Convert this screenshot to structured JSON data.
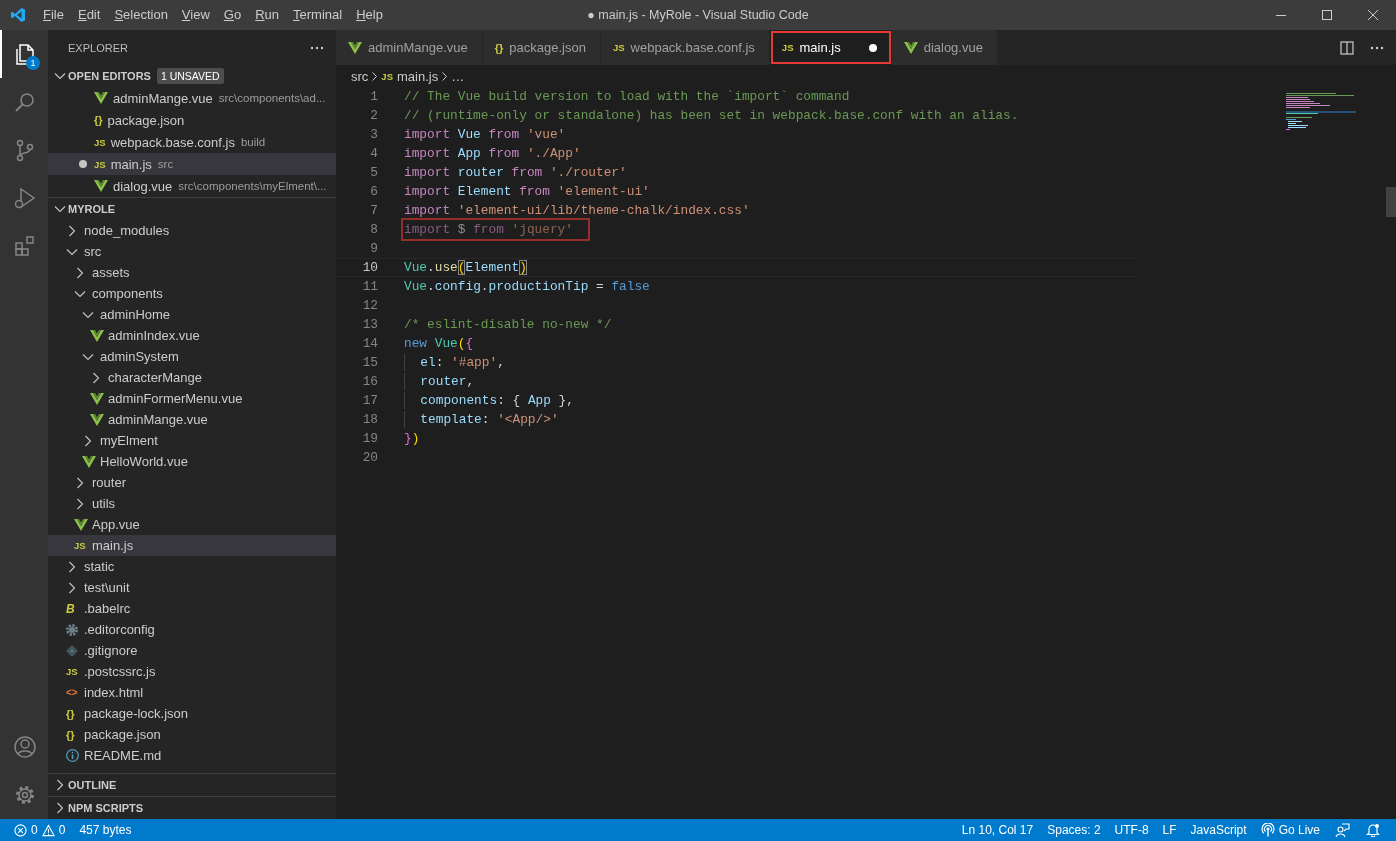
{
  "title_bar": {
    "menu": [
      "File",
      "Edit",
      "Selection",
      "View",
      "Go",
      "Run",
      "Terminal",
      "Help"
    ],
    "title": "● main.js - MyRole - Visual Studio Code"
  },
  "activity_bar": {
    "top": [
      {
        "kind": "files",
        "selected": true,
        "badge": "1"
      },
      {
        "kind": "search",
        "selected": false
      },
      {
        "kind": "source-control",
        "selected": false
      },
      {
        "kind": "run",
        "selected": false
      },
      {
        "kind": "extensions",
        "selected": false
      }
    ],
    "bottom": [
      {
        "kind": "account",
        "selected": false
      },
      {
        "kind": "settings",
        "selected": false
      }
    ]
  },
  "sidebar": {
    "title": "EXPLORER",
    "open_editors": {
      "title": "OPEN EDITORS",
      "expanded": true,
      "badge": "1 UNSAVED",
      "items": [
        {
          "name": "adminMange.vue",
          "description": "src\\components\\ad...",
          "kind": "vue",
          "dirty": false,
          "selected": false
        },
        {
          "name": "package.json",
          "kind": "json",
          "icon_text": "{}",
          "dirty": false,
          "selected": false
        },
        {
          "name": "webpack.base.conf.js",
          "description": "build",
          "kind": "js",
          "icon_text": "JS",
          "dirty": false,
          "selected": false
        },
        {
          "name": "main.js",
          "description": "src",
          "kind": "js",
          "icon_text": "JS",
          "dirty": true,
          "selected": true
        },
        {
          "name": "dialog.vue",
          "description": "src\\components\\myElment\\...",
          "kind": "vue",
          "dirty": false,
          "selected": false
        }
      ]
    },
    "folder": {
      "title": "MYROLE",
      "expanded": true,
      "tree": [
        {
          "name": "node_modules",
          "kind": "folder",
          "expanded": false,
          "selected": false
        },
        {
          "name": "src",
          "kind": "folder",
          "expanded": true,
          "selected": false,
          "children": [
            {
              "name": "assets",
              "kind": "folder",
              "expanded": false,
              "selected": false
            },
            {
              "name": "components",
              "kind": "folder",
              "expanded": true,
              "selected": false,
              "children": [
                {
                  "name": "adminHome",
                  "kind": "folder",
                  "expanded": true,
                  "selected": false,
                  "children": [
                    {
                      "name": "adminIndex.vue",
                      "kind": "vue",
                      "selected": false
                    }
                  ]
                },
                {
                  "name": "adminSystem",
                  "kind": "folder",
                  "expanded": true,
                  "selected": false,
                  "children": [
                    {
                      "name": "characterMange",
                      "kind": "folder",
                      "expanded": false,
                      "selected": false
                    },
                    {
                      "name": "adminFormerMenu.vue",
                      "kind": "vue",
                      "selected": false
                    },
                    {
                      "name": "adminMange.vue",
                      "kind": "vue",
                      "selected": false
                    }
                  ]
                },
                {
                  "name": "myElment",
                  "kind": "folder",
                  "expanded": false,
                  "selected": false
                },
                {
                  "name": "HelloWorld.vue",
                  "kind": "vue",
                  "selected": false
                }
              ]
            },
            {
              "name": "router",
              "kind": "folder",
              "expanded": false,
              "selected": false
            },
            {
              "name": "utils",
              "kind": "folder",
              "expanded": false,
              "selected": false
            },
            {
              "name": "App.vue",
              "kind": "vue",
              "selected": false
            },
            {
              "name": "main.js",
              "kind": "js",
              "icon_text": "JS",
              "selected": true
            }
          ]
        },
        {
          "name": "static",
          "kind": "folder",
          "expanded": false,
          "selected": false
        },
        {
          "name": "test\\unit",
          "kind": "folder",
          "expanded": false,
          "selected": false
        },
        {
          "name": ".babelrc",
          "kind": "babel",
          "icon_text": "B",
          "selected": false
        },
        {
          "name": ".editorconfig",
          "kind": "gear",
          "selected": false
        },
        {
          "name": ".gitignore",
          "kind": "git",
          "selected": false
        },
        {
          "name": ".postcssrc.js",
          "kind": "js",
          "icon_text": "JS",
          "selected": false
        },
        {
          "name": "index.html",
          "kind": "html",
          "icon_text": "<>",
          "selected": false
        },
        {
          "name": "package-lock.json",
          "kind": "json",
          "icon_text": "{}",
          "selected": false
        },
        {
          "name": "package.json",
          "kind": "json",
          "icon_text": "{}",
          "selected": false
        },
        {
          "name": "README.md",
          "kind": "info",
          "selected": false
        }
      ]
    },
    "collapsed_sections": [
      {
        "title": "OUTLINE",
        "expanded": false
      },
      {
        "title": "NPM SCRIPTS",
        "expanded": false
      }
    ]
  },
  "editor": {
    "tabs": [
      {
        "label": "adminMange.vue",
        "kind": "vue",
        "selected": false,
        "dirty": false,
        "annotated": false
      },
      {
        "label": "package.json",
        "kind": "json",
        "icon_text": "{}",
        "selected": false,
        "dirty": false,
        "annotated": false
      },
      {
        "label": "webpack.base.conf.js",
        "kind": "js",
        "icon_text": "JS",
        "selected": false,
        "dirty": false,
        "annotated": false
      },
      {
        "label": "main.js",
        "kind": "js",
        "icon_text": "JS",
        "selected": true,
        "dirty": true,
        "annotated": true
      },
      {
        "label": "dialog.vue",
        "kind": "vue",
        "selected": false,
        "dirty": false,
        "annotated": false
      }
    ],
    "breadcrumb": [
      {
        "label": "src"
      },
      {
        "label": "main.js",
        "kind": "js",
        "icon_text": "JS"
      },
      {
        "label": "…"
      }
    ],
    "lines": [
      {
        "number": "1",
        "current": false,
        "faded": false,
        "annotated": false,
        "guide": false,
        "tokens": [
          {
            "text": "// The Vue build version to load with the `import` command",
            "kind": "com"
          }
        ]
      },
      {
        "number": "2",
        "current": false,
        "faded": false,
        "annotated": false,
        "guide": false,
        "tokens": [
          {
            "text": "// (runtime-only or standalone) has been set in webpack.base.conf with an alias.",
            "kind": "com"
          }
        ]
      },
      {
        "number": "3",
        "current": false,
        "faded": false,
        "annotated": false,
        "guide": false,
        "tokens": [
          {
            "text": "import",
            "kind": "kw"
          },
          {
            "text": " Vue",
            "kind": "var"
          },
          {
            "text": " from",
            "kind": "kw"
          },
          {
            "text": " 'vue'",
            "kind": "str"
          }
        ]
      },
      {
        "number": "4",
        "current": false,
        "faded": false,
        "annotated": false,
        "guide": false,
        "tokens": [
          {
            "text": "import",
            "kind": "kw"
          },
          {
            "text": " App",
            "kind": "var"
          },
          {
            "text": " from",
            "kind": "kw"
          },
          {
            "text": " './App'",
            "kind": "str"
          }
        ]
      },
      {
        "number": "5",
        "current": false,
        "faded": false,
        "annotated": false,
        "guide": false,
        "tokens": [
          {
            "text": "import",
            "kind": "kw"
          },
          {
            "text": " router",
            "kind": "var"
          },
          {
            "text": " from",
            "kind": "kw"
          },
          {
            "text": " './router'",
            "kind": "str"
          }
        ]
      },
      {
        "number": "6",
        "current": false,
        "faded": false,
        "annotated": false,
        "guide": false,
        "tokens": [
          {
            "text": "import",
            "kind": "kw"
          },
          {
            "text": " Element",
            "kind": "var"
          },
          {
            "text": " from",
            "kind": "kw"
          },
          {
            "text": " 'element-ui'",
            "kind": "str"
          }
        ]
      },
      {
        "number": "7",
        "current": false,
        "faded": false,
        "annotated": false,
        "guide": false,
        "tokens": [
          {
            "text": "import",
            "kind": "kw"
          },
          {
            "text": " 'element-ui/lib/theme-chalk/index.css'",
            "kind": "str"
          }
        ]
      },
      {
        "number": "8",
        "current": false,
        "faded": true,
        "annotated": true,
        "guide": false,
        "tokens": [
          {
            "text": "import",
            "kind": "kw"
          },
          {
            "text": " $ ",
            "kind": "pl"
          },
          {
            "text": "from",
            "kind": "kw"
          },
          {
            "text": " 'jquery'",
            "kind": "str"
          }
        ]
      },
      {
        "number": "9",
        "current": false
      },
      {
        "number": "10",
        "current": true,
        "faded": false,
        "annotated": false,
        "guide": false,
        "tokens": [
          {
            "text": "Vue",
            "kind": "cls"
          },
          {
            "text": ".",
            "kind": "pl"
          },
          {
            "text": "use",
            "kind": "fn"
          },
          {
            "text": "(",
            "kind": "match"
          },
          {
            "text": "Element",
            "kind": "var"
          },
          {
            "text": ")",
            "kind": "match"
          }
        ]
      },
      {
        "number": "11",
        "current": false,
        "faded": false,
        "annotated": false,
        "guide": false,
        "tokens": [
          {
            "text": "Vue",
            "kind": "cls"
          },
          {
            "text": ".",
            "kind": "pl"
          },
          {
            "text": "config",
            "kind": "var"
          },
          {
            "text": ".",
            "kind": "pl"
          },
          {
            "text": "productionTip",
            "kind": "var"
          },
          {
            "text": " = ",
            "kind": "pl"
          },
          {
            "text": "false",
            "kind": "bool"
          }
        ]
      },
      {
        "number": "12",
        "current": false
      },
      {
        "number": "13",
        "current": false,
        "faded": false,
        "annotated": false,
        "guide": false,
        "tokens": [
          {
            "text": "/* eslint-disable no-new */",
            "kind": "com"
          }
        ]
      },
      {
        "number": "14",
        "current": false,
        "faded": false,
        "annotated": false,
        "guide": false,
        "tokens": [
          {
            "text": "new",
            "kind": "bool"
          },
          {
            "text": " Vue",
            "kind": "cls"
          },
          {
            "text": "(",
            "kind": "paren"
          },
          {
            "text": "{",
            "kind": "brace"
          }
        ]
      },
      {
        "number": "15",
        "current": false,
        "faded": false,
        "annotated": false,
        "guide": true,
        "tokens": [
          {
            "text": "  el",
            "kind": "var"
          },
          {
            "text": ": ",
            "kind": "pl"
          },
          {
            "text": "'#app'",
            "kind": "str"
          },
          {
            "text": ",",
            "kind": "pl"
          }
        ]
      },
      {
        "number": "16",
        "current": false,
        "faded": false,
        "annotated": false,
        "guide": true,
        "tokens": [
          {
            "text": "  router",
            "kind": "var"
          },
          {
            "text": ",",
            "kind": "pl"
          }
        ]
      },
      {
        "number": "17",
        "current": false,
        "faded": false,
        "annotated": false,
        "guide": true,
        "tokens": [
          {
            "text": "  components",
            "kind": "var"
          },
          {
            "text": ": { ",
            "kind": "pl"
          },
          {
            "text": "App",
            "kind": "var"
          },
          {
            "text": " },",
            "kind": "pl"
          }
        ]
      },
      {
        "number": "18",
        "current": false,
        "faded": false,
        "annotated": false,
        "guide": true,
        "tokens": [
          {
            "text": "  template",
            "kind": "var"
          },
          {
            "text": ": ",
            "kind": "pl"
          },
          {
            "text": "'<App/>'",
            "kind": "str"
          }
        ]
      },
      {
        "number": "19",
        "current": false,
        "faded": false,
        "annotated": false,
        "guide": false,
        "tokens": [
          {
            "text": "}",
            "kind": "brace"
          },
          {
            "text": ")",
            "kind": "paren"
          }
        ]
      },
      {
        "number": "20",
        "current": false
      }
    ]
  },
  "status_bar": {
    "errors": "0",
    "warnings": "0",
    "left": [
      "457 bytes"
    ],
    "right": [
      {
        "label": "Ln 10, Col 17"
      },
      {
        "label": "Spaces: 2"
      },
      {
        "label": "UTF-8"
      },
      {
        "label": "LF"
      },
      {
        "label": "JavaScript"
      },
      {
        "label": "Go Live",
        "kind": "broadcast"
      },
      {
        "kind": "feedback"
      },
      {
        "kind": "bell"
      }
    ]
  }
}
